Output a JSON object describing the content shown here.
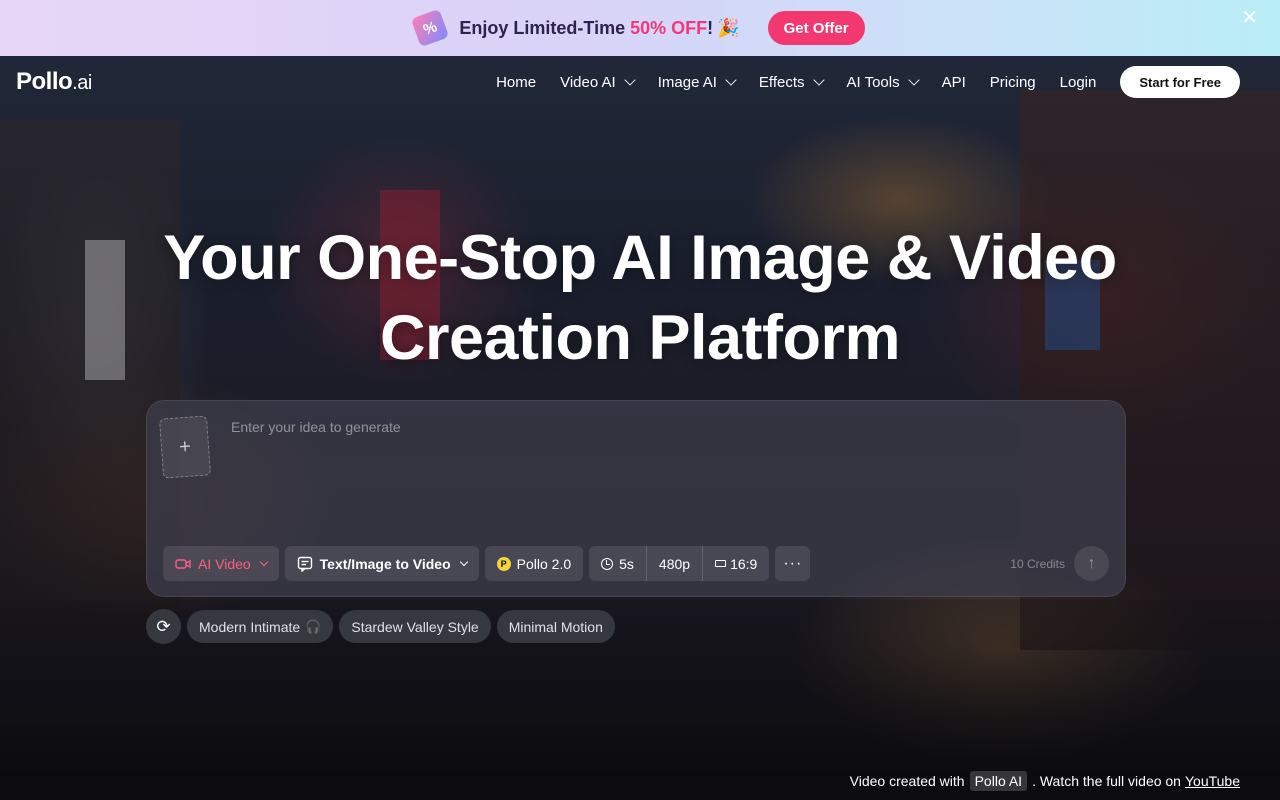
{
  "promo": {
    "text": "Enjoy Limited-Time",
    "highlight": "50% OFF",
    "suffix": "!",
    "party_emoji": "🎉",
    "button": "Get Offer",
    "close": "✕"
  },
  "nav": {
    "logo_main": "Pollo",
    "logo_suffix": ".ai",
    "items": [
      {
        "label": "Home",
        "dropdown": false
      },
      {
        "label": "Video AI",
        "dropdown": true
      },
      {
        "label": "Image AI",
        "dropdown": true
      },
      {
        "label": "Effects",
        "dropdown": true
      },
      {
        "label": "AI Tools",
        "dropdown": true
      },
      {
        "label": "API",
        "dropdown": false
      },
      {
        "label": "Pricing",
        "dropdown": false
      },
      {
        "label": "Login",
        "dropdown": false
      }
    ],
    "cta": "Start for Free"
  },
  "hero": {
    "title_line1": "Your One-Stop AI Image & Video",
    "title_line2": "Creation Platform"
  },
  "prompt": {
    "upload_icon": "+",
    "placeholder": "Enter your idea to generate",
    "value": "",
    "type_chip": "AI Video",
    "mode_chip": "Text/Image to Video",
    "model_badge": "P",
    "model_chip": "Pollo 2.0",
    "duration": "5s",
    "resolution": "480p",
    "ratio": "16:9",
    "more": "···",
    "credits": "10 Credits",
    "send_icon": "↑"
  },
  "suggestions": {
    "refresh_icon": "⟳",
    "items": [
      "Modern Intimate",
      "Stardew Valley Style",
      "Minimal Motion"
    ],
    "first_item_emoji": "🎧"
  },
  "footer": {
    "prefix": "Video created with",
    "tag": "Pollo AI",
    "middle": ". Watch the full video on",
    "link": "YouTube"
  },
  "colors": {
    "accent_pink": "#f2386e",
    "ai_video_red": "#ff5f7e"
  }
}
